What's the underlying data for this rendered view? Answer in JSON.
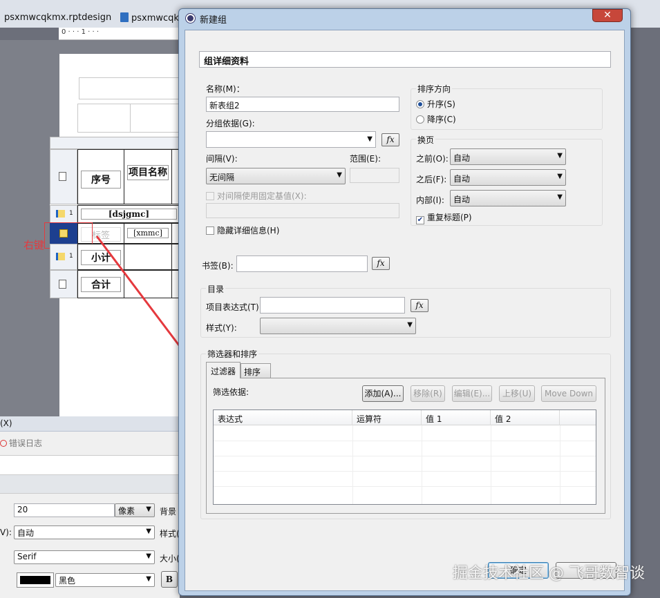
{
  "background": {
    "tabs": [
      {
        "label": "psxmwcqkmx.rptdesign"
      },
      {
        "label": "psxmwcqkmx"
      }
    ],
    "ruler_text": "0 · · · 1 · · ·",
    "report": {
      "headers": [
        "序号",
        "项目名称"
      ],
      "row_detail": "[dsjgmc]",
      "row_label": "标签",
      "row_xmmc": "[xmmc]",
      "row_subtotal": "小计",
      "row_total": "合计",
      "group_num": "1"
    },
    "right_click_label": "右键",
    "bottom": {
      "close_x": "(X)",
      "error_log": "错误日志",
      "size_value": "20",
      "size_unit": "像素",
      "bg_label": "背景",
      "v_label": "V):",
      "auto_value": "自动",
      "style_label": "样式(",
      "font_value": "Serif",
      "size_label": "大小(",
      "color_value": "黑色",
      "bold_label": "B"
    },
    "watermark": "掘金技术社区 @ 飞哥数智谈"
  },
  "dialog": {
    "title": "新建组",
    "close_label": "✕",
    "header": "组详细资料",
    "name_label": "名称(M)：",
    "name_value": "新表组2",
    "group_by_label": "分组依据(G):",
    "group_by_value": "",
    "fx_label": "fx",
    "interval_label": "间隔(V):",
    "interval_value": "无间隔",
    "range_label": "范围(E):",
    "range_value": "",
    "fixed_base_label": "对间隔使用固定基值(X):",
    "fixed_base_value": "",
    "hide_detail_label": "隐藏详细信息(H)",
    "sort_direction": {
      "title": "排序方向",
      "asc": "升序(S)",
      "desc": "降序(C)",
      "selected": "asc"
    },
    "page_break": {
      "title": "换页",
      "before_label": "之前(O):",
      "before_value": "自动",
      "after_label": "之后(F):",
      "after_value": "自动",
      "inside_label": "内部(I):",
      "inside_value": "自动",
      "repeat_header_label": "重复标题(P)",
      "repeat_header_checked": true
    },
    "bookmark_label": "书签(B):",
    "bookmark_value": "",
    "toc": {
      "title": "目录",
      "item_expr_label": "项目表达式(T)",
      "item_expr_value": "",
      "style_label": "样式(Y):",
      "style_value": ""
    },
    "filter_sort": {
      "title": "筛选器和排序",
      "tabs": [
        {
          "label": "过滤器",
          "active": true
        },
        {
          "label": "排序",
          "active": false
        }
      ],
      "filter_by_label": "筛选依据:",
      "buttons": {
        "add": "添加(A)...",
        "remove": "移除(R)",
        "edit": "编辑(E)...",
        "up": "上移(U)",
        "down": "Move Down"
      },
      "columns": [
        "表达式",
        "运算符",
        "值 1",
        "值 2"
      ],
      "rows": []
    },
    "ok_label": "确定"
  }
}
